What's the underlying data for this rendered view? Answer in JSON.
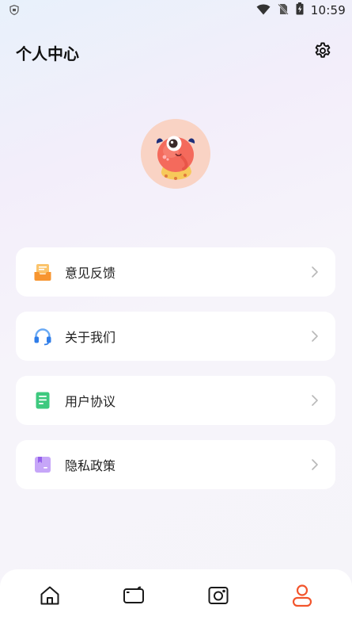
{
  "status_bar": {
    "time": "10:59",
    "icons": [
      "shield-notification-icon",
      "wifi-icon",
      "no-sim-icon",
      "battery-charging-icon"
    ]
  },
  "header": {
    "title": "个人中心",
    "settings_icon": "gear-icon"
  },
  "profile": {
    "avatar_icon": "monster-avatar"
  },
  "menu": [
    {
      "label": "意见反馈",
      "icon": "feedback-inbox-icon",
      "color": "#f7a540"
    },
    {
      "label": "关于我们",
      "icon": "headset-icon",
      "color": "#4a8ef0"
    },
    {
      "label": "用户协议",
      "icon": "document-icon",
      "color": "#3ec97f"
    },
    {
      "label": "隐私政策",
      "icon": "privacy-folder-icon",
      "color": "#b18af5"
    }
  ],
  "tabbar": {
    "items": [
      {
        "name": "home",
        "icon": "home-icon",
        "active": false
      },
      {
        "name": "video",
        "icon": "video-icon",
        "active": false
      },
      {
        "name": "camera",
        "icon": "camera-icon",
        "active": false
      },
      {
        "name": "profile",
        "icon": "user-icon",
        "active": true
      }
    ],
    "active_color": "#f2552c",
    "inactive_color": "#1a1a1a"
  }
}
